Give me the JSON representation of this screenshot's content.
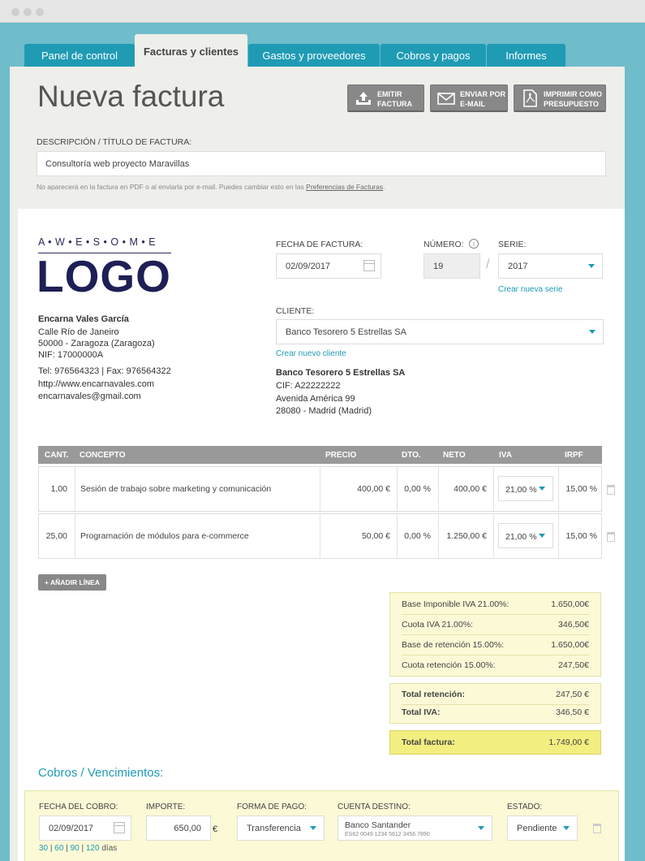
{
  "tabs": [
    "Panel de control",
    "Facturas y clientes",
    "Gastos y proveedores",
    "Cobros y pagos",
    "Informes"
  ],
  "page_title": "Nueva factura",
  "actions": {
    "emit": [
      "EMITIR",
      "FACTURA"
    ],
    "email": [
      "ENVIAR POR",
      "E-MAIL"
    ],
    "print": [
      "IMPRIMIR COMO",
      "PRESUPUESTO"
    ]
  },
  "description": {
    "label": "DESCRIPCIÓN / TÍTULO DE FACTURA:",
    "value": "Consultoría web proyecto Maravillas",
    "hint": "No aparecerá en la factura en PDF o al enviarla por e-mail. Puedes cambiar esto en las ",
    "hint_link": "Preferencias de Facturas",
    "hint_end": "."
  },
  "logo": {
    "top": "A • W • E • S • O • M • E",
    "main": "LOGO"
  },
  "issuer": {
    "name": "Encarna Vales García",
    "lines": [
      "Calle Río de Janeiro",
      "50000 - Zaragoza (Zaragoza)",
      "NIF: 17000000A"
    ],
    "phone": "Tel: 976564323 | Fax: 976564322",
    "web": "http://www.encarnavales.com",
    "email": "encarnavales@gmail.com"
  },
  "invoice": {
    "date_label": "FECHA DE FACTURA:",
    "date": "02/09/2017",
    "number_label": "NÚMERO:",
    "number": "19",
    "slash": "/",
    "series_label": "SERIE:",
    "series": "2017",
    "new_series": "Crear nueva serie",
    "client_label": "CLIENTE:",
    "client": "Banco Tesorero 5 Estrellas SA",
    "new_client": "Crear nuevo cliente"
  },
  "client_info": {
    "name": "Banco Tesorero 5 Estrellas SA",
    "lines": [
      "CIF: A22222222",
      "Avenida América 99",
      "28080 - Madrid (Madrid)"
    ]
  },
  "table": {
    "headers": [
      "CANT.",
      "CONCEPTO",
      "PRECIO",
      "DTO.",
      "NETO",
      "IVA",
      "IRPF"
    ],
    "rows": [
      {
        "qty": "1,00",
        "concept": "Sesión de trabajo sobre marketing y comunicación",
        "price": "400,00 €",
        "dto": "0,00 %",
        "net": "400,00 €",
        "iva": "21,00 %",
        "irpf": "15,00 %"
      },
      {
        "qty": "25,00",
        "concept": "Programación de módulos para e-commerce",
        "price": "50,00 €",
        "dto": "0,00 %",
        "net": "1.250,00 €",
        "iva": "21,00 %",
        "irpf": "15,00 %"
      }
    ],
    "add_line": "+ AÑADIR LÍNEA"
  },
  "summary": {
    "base": [
      {
        "label": "Base Imponible IVA 21.00%:",
        "value": "1.650,00€"
      },
      {
        "label": "Cuota IVA 21.00%:",
        "value": "346,50€"
      },
      {
        "label": "Base de retención 15.00%:",
        "value": "1.650,00€"
      },
      {
        "label": "Cuota retención 15.00%:",
        "value": "247,50€"
      }
    ],
    "totals": [
      {
        "label": "Total retención:",
        "value": "247,50 €"
      },
      {
        "label": "Total IVA:",
        "value": "346,50 €"
      }
    ],
    "total": {
      "label": "Total factura:",
      "value": "1.749,00 €"
    }
  },
  "cobros": {
    "title": "Cobros / Vencimientos:",
    "date_label": "FECHA DEL COBRO:",
    "date": "02/09/2017",
    "quick": [
      "30",
      "60",
      "90",
      "120"
    ],
    "quick_sep": "|",
    "quick_suffix": "días",
    "amount_label": "IMPORTE:",
    "amount": "650,00",
    "currency": "€",
    "method_label": "FORMA DE PAGO:",
    "method": "Transferencia",
    "account_label": "CUENTA DESTINO:",
    "account_name": "Banco Santander",
    "account_iban": "ES62 0049 1234 5612 3456 7890",
    "status_label": "ESTADO:",
    "status": "Pendiente"
  },
  "colors": {
    "accent": "#1f9bb4",
    "background": "#6fbccb",
    "total_highlight": "#f2ee80"
  }
}
